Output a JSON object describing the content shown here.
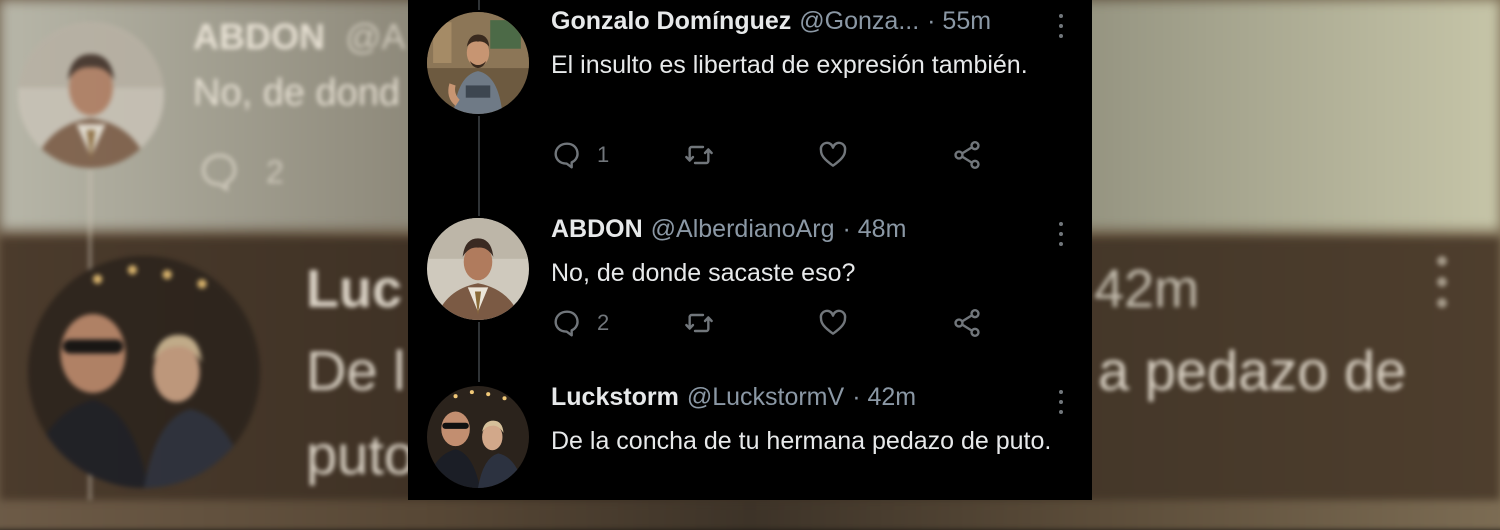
{
  "background": {
    "blurred_tweets": [
      {
        "name": "ABDON",
        "handle": "@A",
        "text": "No, de dond",
        "reply_count": "2"
      },
      {
        "name": "Luc",
        "time": "42m",
        "text_line1_left": "De l",
        "text_line1_right": "a pedazo de",
        "text_line2": "puto"
      }
    ]
  },
  "tweets": [
    {
      "name": "Gonzalo Domínguez",
      "handle": "@Gonza...",
      "time": "· 55m",
      "text": "El insulto es libertad de expresión también.",
      "reply_count": "1",
      "retweet_count": "",
      "like_count": ""
    },
    {
      "name": "ABDON",
      "handle": "@AlberdianoArg",
      "time": "· 48m",
      "text": "No, de donde sacaste eso?",
      "reply_count": "2",
      "retweet_count": "",
      "like_count": ""
    },
    {
      "name": "Luckstorm",
      "handle": "@LuckstormV",
      "time": "· 42m",
      "text": "De la concha de tu hermana pedazo de puto."
    }
  ],
  "colors": {
    "panel_bg": "#000000",
    "text_primary": "#e7e9ea",
    "text_secondary": "#8b98a5",
    "icon": "#71767b"
  },
  "icons": [
    "reply-icon",
    "retweet-icon",
    "like-icon",
    "share-icon",
    "more-options-icon"
  ]
}
